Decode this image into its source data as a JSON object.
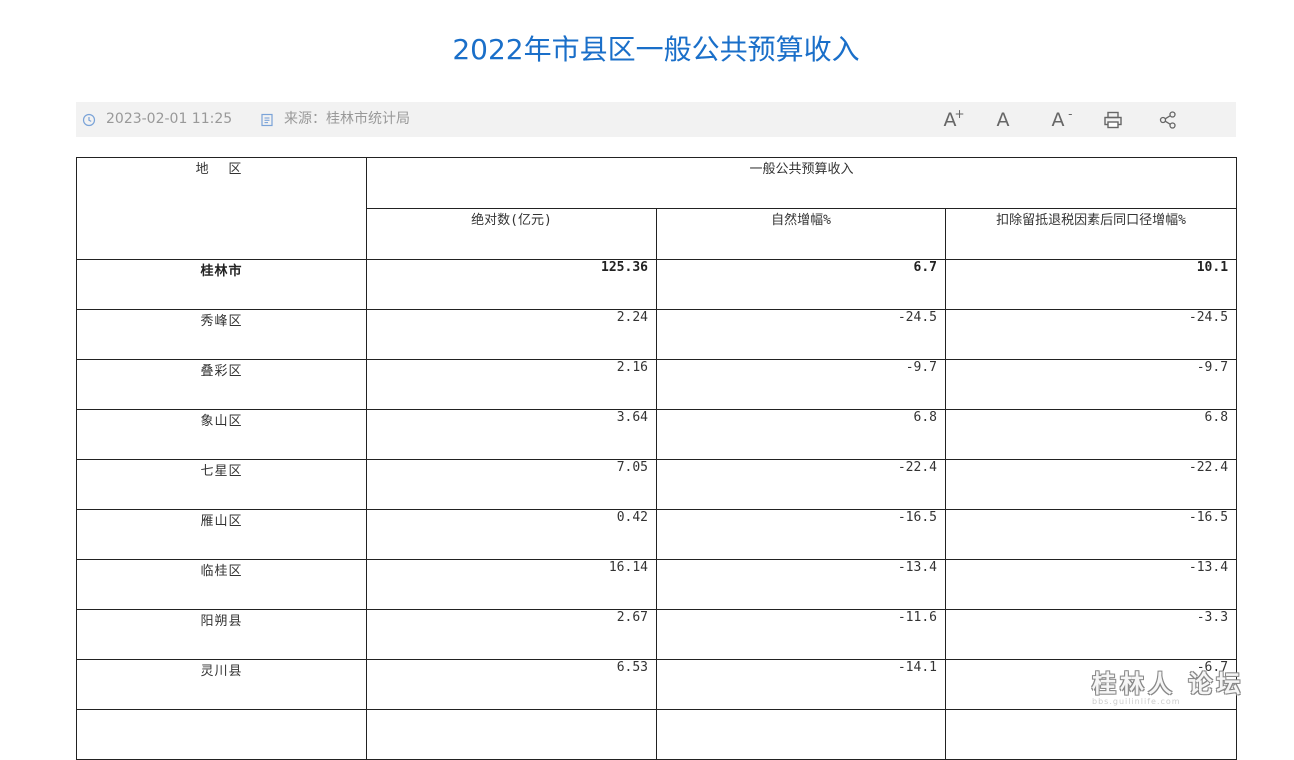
{
  "page": {
    "title": "2022年市县区一般公共预算收入"
  },
  "meta": {
    "datetime": "2023-02-01 11:25",
    "source": "来源：桂林市统计局"
  },
  "toolbar": {
    "font_larger": "A",
    "font_larger_sup": "+",
    "font_default": "A",
    "font_smaller": "A",
    "font_smaller_sup": "-",
    "icons": [
      "clock-icon",
      "document-icon",
      "print-icon",
      "share-icon"
    ]
  },
  "table": {
    "header": {
      "region": "地 区",
      "group": "一般公共预算收入",
      "col1": "绝对数(亿元)",
      "col2": "自然增幅%",
      "col3": "扣除留抵退税因素后同口径增幅%"
    },
    "rows": [
      {
        "region": "桂林市",
        "abs": "125.36",
        "growth": "6.7",
        "adj": "10.1"
      },
      {
        "region": "秀峰区",
        "abs": "2.24",
        "growth": "-24.5",
        "adj": "-24.5"
      },
      {
        "region": "叠彩区",
        "abs": "2.16",
        "growth": "-9.7",
        "adj": "-9.7"
      },
      {
        "region": "象山区",
        "abs": "3.64",
        "growth": "6.8",
        "adj": "6.8"
      },
      {
        "region": "七星区",
        "abs": "7.05",
        "growth": "-22.4",
        "adj": "-22.4"
      },
      {
        "region": "雁山区",
        "abs": "0.42",
        "growth": "-16.5",
        "adj": "-16.5"
      },
      {
        "region": "临桂区",
        "abs": "16.14",
        "growth": "-13.4",
        "adj": "-13.4"
      },
      {
        "region": "阳朔县",
        "abs": "2.67",
        "growth": "-11.6",
        "adj": "-3.3"
      },
      {
        "region": "灵川县",
        "abs": "6.53",
        "growth": "-14.1",
        "adj": "-6.7"
      }
    ]
  },
  "watermark": {
    "main": "桂林人 论坛",
    "sub": "bbs.guilinlife.com"
  }
}
